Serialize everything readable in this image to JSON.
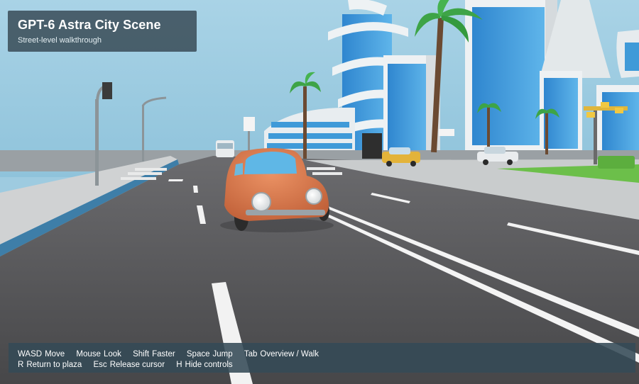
{
  "overlay": {
    "title": "GPT-6 Astra City Scene",
    "subtitle": "Street-level walkthrough"
  },
  "controls": {
    "row1": [
      {
        "key": "WASD",
        "action": "Move"
      },
      {
        "key": "Mouse",
        "action": "Look"
      },
      {
        "key": "Shift",
        "action": "Faster"
      },
      {
        "key": "Space",
        "action": "Jump"
      },
      {
        "key": "Tab",
        "action": "Overview / Walk"
      }
    ],
    "row2": [
      {
        "key": "R",
        "action": "Return to plaza"
      },
      {
        "key": "Esc",
        "action": "Release cursor"
      },
      {
        "key": "H",
        "action": "Hide controls"
      }
    ]
  },
  "colors": {
    "sky": "#9ecbe0",
    "road": "#4e4e50",
    "car": "#d9774a",
    "grass": "#6cbf4a",
    "glass": "#3f9ad8",
    "panel": "#34464f"
  }
}
